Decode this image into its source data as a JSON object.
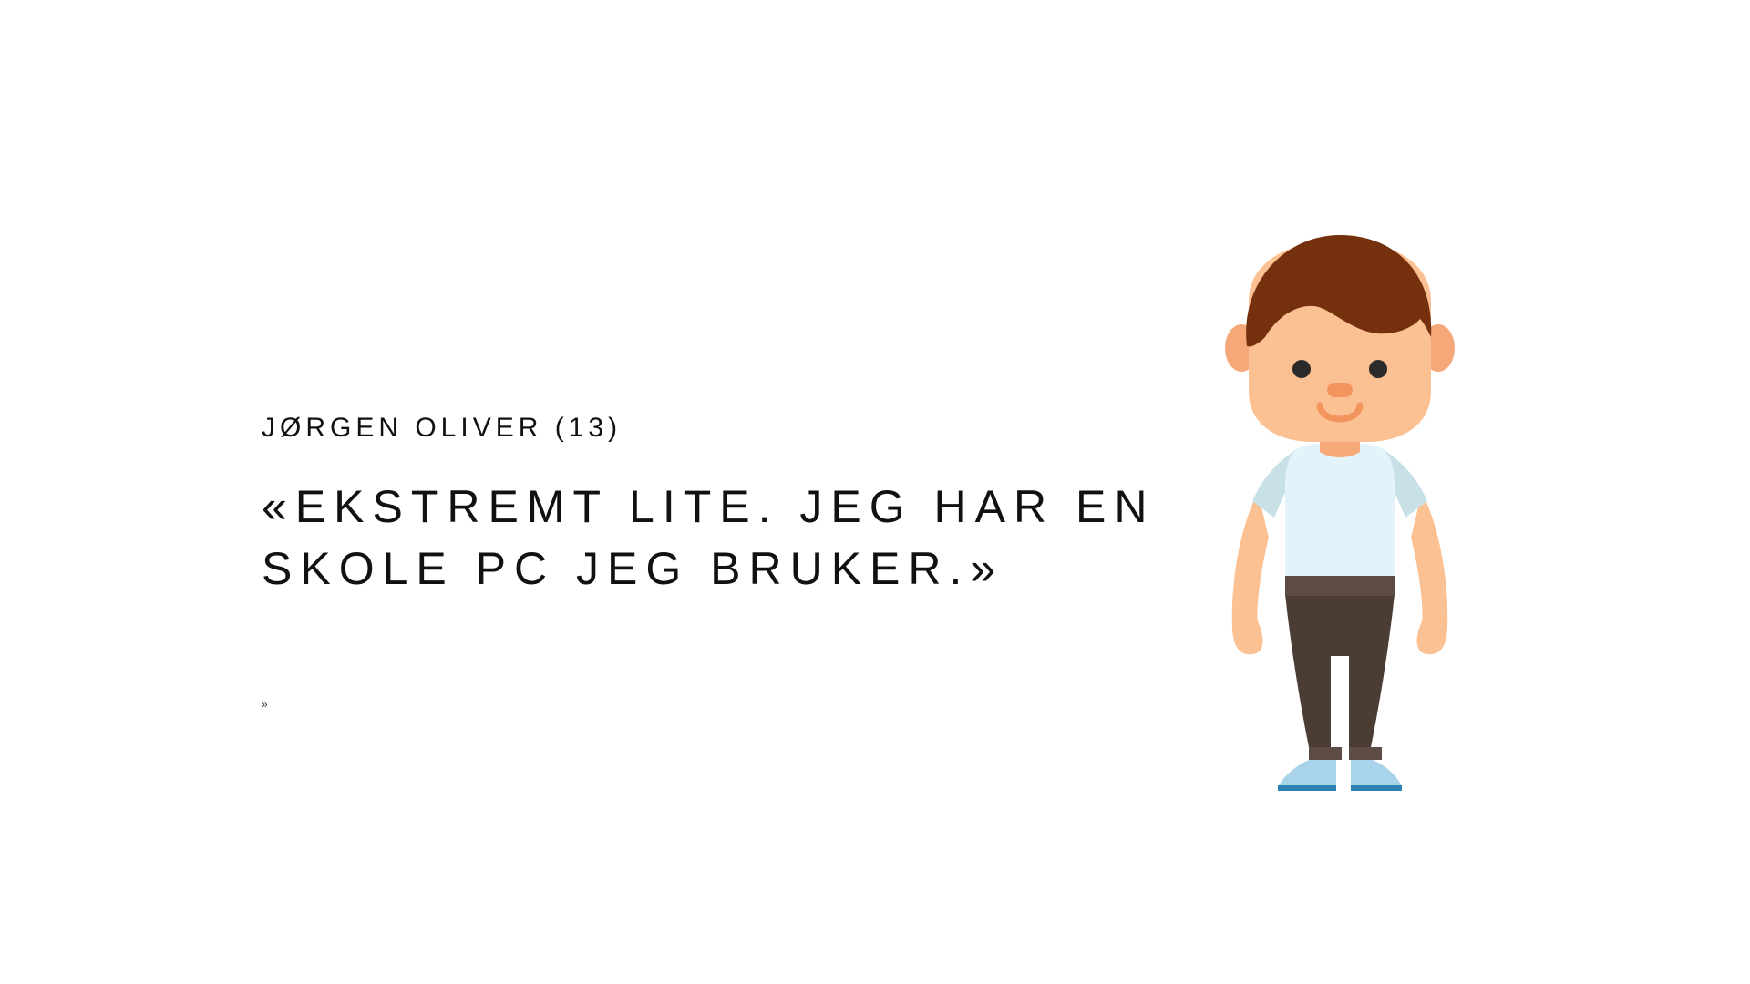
{
  "slide": {
    "name": "JØRGEN OLIVER (13)",
    "quote_line_1": "«EKSTREMT LITE. JEG HAR EN",
    "quote_line_2": "SKOLE PC JEG BRUKER.»",
    "closing_mark": "»"
  },
  "illustration": {
    "icon": "boy-character-icon",
    "colors": {
      "hair": "#75310e",
      "skin": "#fcc193",
      "ear_inner": "#f7a878",
      "nose": "#f3945e",
      "eyes": "#2d2a2a",
      "shirt": "#e2f4f9",
      "sleeves": "#c7e1e6",
      "belt": "#5e4d46",
      "pants": "#4b3d34",
      "shoes": "#a9d3ea",
      "soles": "#2e82b3"
    }
  }
}
